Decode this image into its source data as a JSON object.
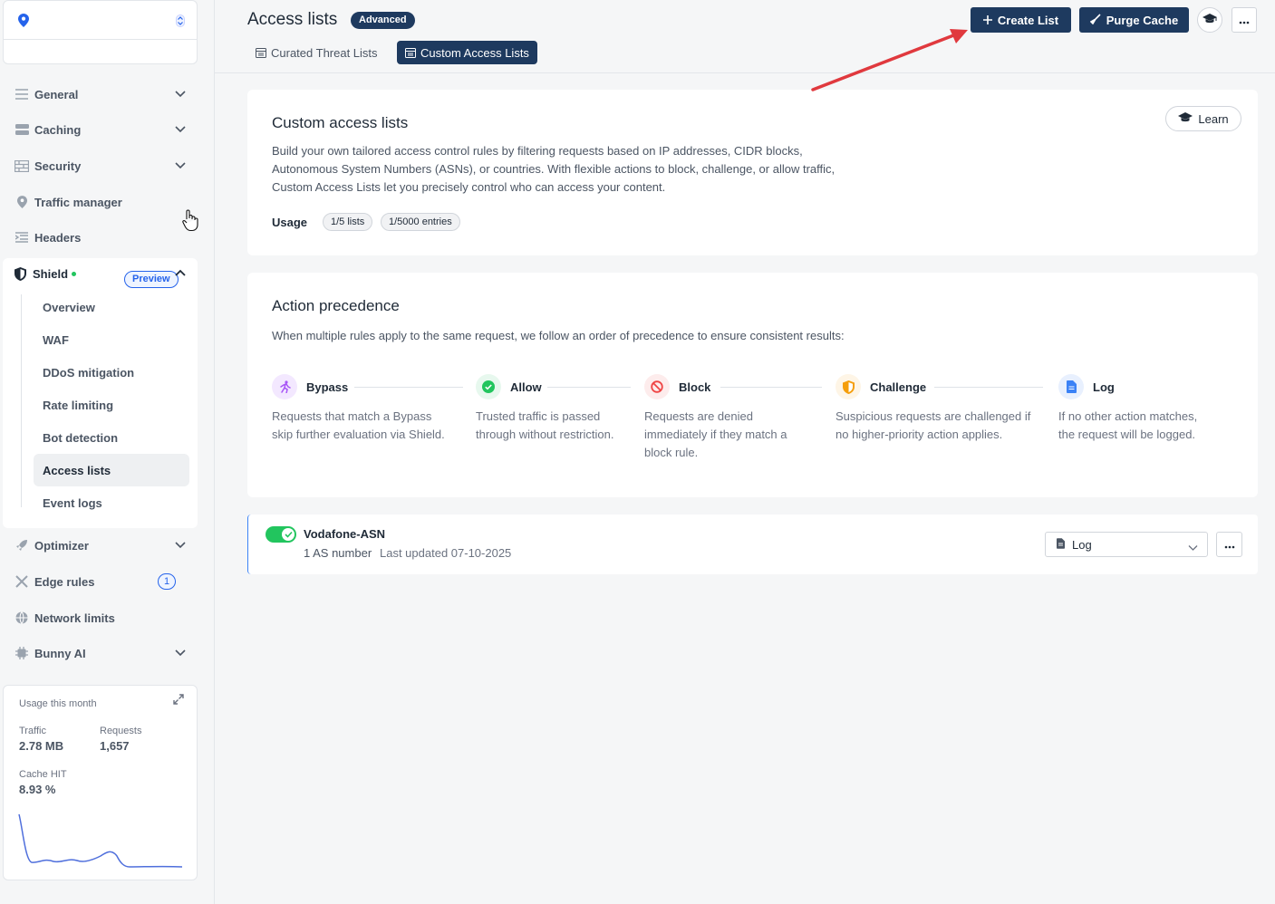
{
  "sidebar": {
    "nav_top": [
      {
        "label": "General",
        "icon": "lines-icon"
      },
      {
        "label": "Caching",
        "icon": "storage-icon"
      },
      {
        "label": "Security",
        "icon": "wall-icon"
      },
      {
        "label": "Traffic manager",
        "icon": "pin-icon"
      },
      {
        "label": "Headers",
        "icon": "headers-icon"
      }
    ],
    "shield": {
      "label": "Shield",
      "badge": "Preview",
      "items": [
        "Overview",
        "WAF",
        "DDoS mitigation",
        "Rate limiting",
        "Bot detection",
        "Access lists",
        "Event logs"
      ],
      "active_item": "Access lists"
    },
    "nav_bottom": [
      {
        "label": "Optimizer",
        "icon": "rocket-icon"
      },
      {
        "label": "Edge rules",
        "icon": "tools-icon",
        "badge": "1"
      },
      {
        "label": "Network limits",
        "icon": "globe-icon"
      },
      {
        "label": "Bunny AI",
        "icon": "chip-icon"
      }
    ],
    "usage": {
      "title": "Usage this month",
      "traffic_label": "Traffic",
      "traffic_value": "2.78 MB",
      "requests_label": "Requests",
      "requests_value": "1,657",
      "cache_label": "Cache HIT",
      "cache_value": "8.93 %",
      "line_color": "#4f6fdc"
    }
  },
  "header": {
    "title": "Access lists",
    "badge": "Advanced",
    "tabs": [
      {
        "label": "Curated Threat Lists",
        "active": false
      },
      {
        "label": "Custom Access Lists",
        "active": true
      }
    ],
    "create_label": "Create List",
    "purge_label": "Purge Cache"
  },
  "intro_card": {
    "title": "Custom access lists",
    "description_lines": [
      "Build your own tailored access control rules by filtering requests based on IP addresses, CIDR blocks,",
      "Autonomous System Numbers (ASNs), or countries. With flexible actions to block, challenge, or allow traffic,",
      "Custom Access Lists let you precisely control who can access your content."
    ],
    "learn_label": "Learn",
    "usage_label": "Usage",
    "usage_pills": [
      "1/5 lists",
      "1/5000 entries"
    ]
  },
  "precedence_card": {
    "title": "Action precedence",
    "description": "When multiple rules apply to the same request, we follow an order of precedence to ensure consistent results:",
    "steps": [
      {
        "label": "Bypass",
        "desc": [
          "Requests that match a Bypass",
          "skip further evaluation via Shield."
        ],
        "color": "#a855f7",
        "bg": "#f3e8ff"
      },
      {
        "label": "Allow",
        "desc": [
          "Trusted traffic is passed",
          "through without restriction."
        ],
        "color": "#22c55e",
        "bg": "#e7f8ee"
      },
      {
        "label": "Block",
        "desc": [
          "Requests are denied",
          "immediately if they match a",
          "block rule."
        ],
        "color": "#ef4444",
        "bg": "#fdecec"
      },
      {
        "label": "Challenge",
        "desc": [
          "Suspicious requests are challenged if",
          "no higher-priority action applies."
        ],
        "color": "#f59e0b",
        "bg": "#fef5e6"
      },
      {
        "label": "Log",
        "desc": [
          "If no other action matches,",
          "the request will be logged."
        ],
        "color": "#3b82f6",
        "bg": "#e8f0fe"
      }
    ]
  },
  "access_list": {
    "name": "Vodafone-ASN",
    "count": "1 AS number",
    "updated": "Last updated 07-10-2025",
    "action": "Log",
    "enabled": true
  },
  "colors": {
    "primary": "#1e3a5f",
    "arrow": "#e0393e"
  }
}
